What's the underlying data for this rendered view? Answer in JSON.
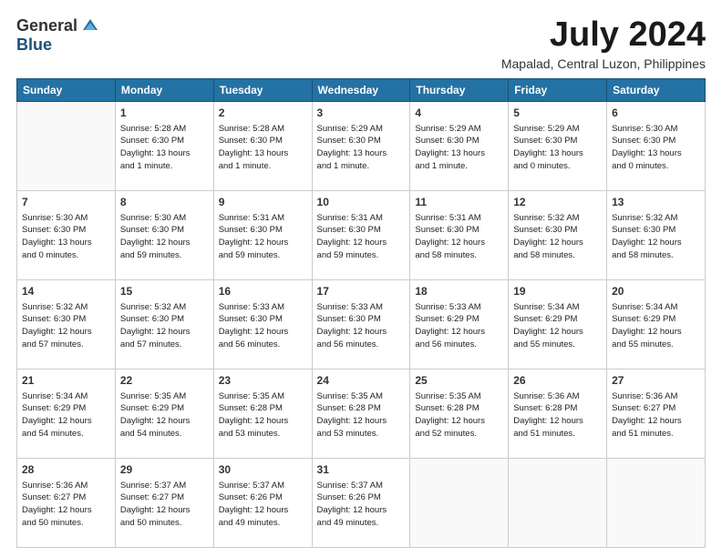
{
  "header": {
    "logo_general": "General",
    "logo_blue": "Blue",
    "month_title": "July 2024",
    "location": "Mapalad, Central Luzon, Philippines"
  },
  "weekdays": [
    "Sunday",
    "Monday",
    "Tuesday",
    "Wednesday",
    "Thursday",
    "Friday",
    "Saturday"
  ],
  "weeks": [
    [
      {
        "day": "",
        "info": ""
      },
      {
        "day": "1",
        "info": "Sunrise: 5:28 AM\nSunset: 6:30 PM\nDaylight: 13 hours\nand 1 minute."
      },
      {
        "day": "2",
        "info": "Sunrise: 5:28 AM\nSunset: 6:30 PM\nDaylight: 13 hours\nand 1 minute."
      },
      {
        "day": "3",
        "info": "Sunrise: 5:29 AM\nSunset: 6:30 PM\nDaylight: 13 hours\nand 1 minute."
      },
      {
        "day": "4",
        "info": "Sunrise: 5:29 AM\nSunset: 6:30 PM\nDaylight: 13 hours\nand 1 minute."
      },
      {
        "day": "5",
        "info": "Sunrise: 5:29 AM\nSunset: 6:30 PM\nDaylight: 13 hours\nand 0 minutes."
      },
      {
        "day": "6",
        "info": "Sunrise: 5:30 AM\nSunset: 6:30 PM\nDaylight: 13 hours\nand 0 minutes."
      }
    ],
    [
      {
        "day": "7",
        "info": "Sunrise: 5:30 AM\nSunset: 6:30 PM\nDaylight: 13 hours\nand 0 minutes."
      },
      {
        "day": "8",
        "info": "Sunrise: 5:30 AM\nSunset: 6:30 PM\nDaylight: 12 hours\nand 59 minutes."
      },
      {
        "day": "9",
        "info": "Sunrise: 5:31 AM\nSunset: 6:30 PM\nDaylight: 12 hours\nand 59 minutes."
      },
      {
        "day": "10",
        "info": "Sunrise: 5:31 AM\nSunset: 6:30 PM\nDaylight: 12 hours\nand 59 minutes."
      },
      {
        "day": "11",
        "info": "Sunrise: 5:31 AM\nSunset: 6:30 PM\nDaylight: 12 hours\nand 58 minutes."
      },
      {
        "day": "12",
        "info": "Sunrise: 5:32 AM\nSunset: 6:30 PM\nDaylight: 12 hours\nand 58 minutes."
      },
      {
        "day": "13",
        "info": "Sunrise: 5:32 AM\nSunset: 6:30 PM\nDaylight: 12 hours\nand 58 minutes."
      }
    ],
    [
      {
        "day": "14",
        "info": "Sunrise: 5:32 AM\nSunset: 6:30 PM\nDaylight: 12 hours\nand 57 minutes."
      },
      {
        "day": "15",
        "info": "Sunrise: 5:32 AM\nSunset: 6:30 PM\nDaylight: 12 hours\nand 57 minutes."
      },
      {
        "day": "16",
        "info": "Sunrise: 5:33 AM\nSunset: 6:30 PM\nDaylight: 12 hours\nand 56 minutes."
      },
      {
        "day": "17",
        "info": "Sunrise: 5:33 AM\nSunset: 6:30 PM\nDaylight: 12 hours\nand 56 minutes."
      },
      {
        "day": "18",
        "info": "Sunrise: 5:33 AM\nSunset: 6:29 PM\nDaylight: 12 hours\nand 56 minutes."
      },
      {
        "day": "19",
        "info": "Sunrise: 5:34 AM\nSunset: 6:29 PM\nDaylight: 12 hours\nand 55 minutes."
      },
      {
        "day": "20",
        "info": "Sunrise: 5:34 AM\nSunset: 6:29 PM\nDaylight: 12 hours\nand 55 minutes."
      }
    ],
    [
      {
        "day": "21",
        "info": "Sunrise: 5:34 AM\nSunset: 6:29 PM\nDaylight: 12 hours\nand 54 minutes."
      },
      {
        "day": "22",
        "info": "Sunrise: 5:35 AM\nSunset: 6:29 PM\nDaylight: 12 hours\nand 54 minutes."
      },
      {
        "day": "23",
        "info": "Sunrise: 5:35 AM\nSunset: 6:28 PM\nDaylight: 12 hours\nand 53 minutes."
      },
      {
        "day": "24",
        "info": "Sunrise: 5:35 AM\nSunset: 6:28 PM\nDaylight: 12 hours\nand 53 minutes."
      },
      {
        "day": "25",
        "info": "Sunrise: 5:35 AM\nSunset: 6:28 PM\nDaylight: 12 hours\nand 52 minutes."
      },
      {
        "day": "26",
        "info": "Sunrise: 5:36 AM\nSunset: 6:28 PM\nDaylight: 12 hours\nand 51 minutes."
      },
      {
        "day": "27",
        "info": "Sunrise: 5:36 AM\nSunset: 6:27 PM\nDaylight: 12 hours\nand 51 minutes."
      }
    ],
    [
      {
        "day": "28",
        "info": "Sunrise: 5:36 AM\nSunset: 6:27 PM\nDaylight: 12 hours\nand 50 minutes."
      },
      {
        "day": "29",
        "info": "Sunrise: 5:37 AM\nSunset: 6:27 PM\nDaylight: 12 hours\nand 50 minutes."
      },
      {
        "day": "30",
        "info": "Sunrise: 5:37 AM\nSunset: 6:26 PM\nDaylight: 12 hours\nand 49 minutes."
      },
      {
        "day": "31",
        "info": "Sunrise: 5:37 AM\nSunset: 6:26 PM\nDaylight: 12 hours\nand 49 minutes."
      },
      {
        "day": "",
        "info": ""
      },
      {
        "day": "",
        "info": ""
      },
      {
        "day": "",
        "info": ""
      }
    ]
  ]
}
